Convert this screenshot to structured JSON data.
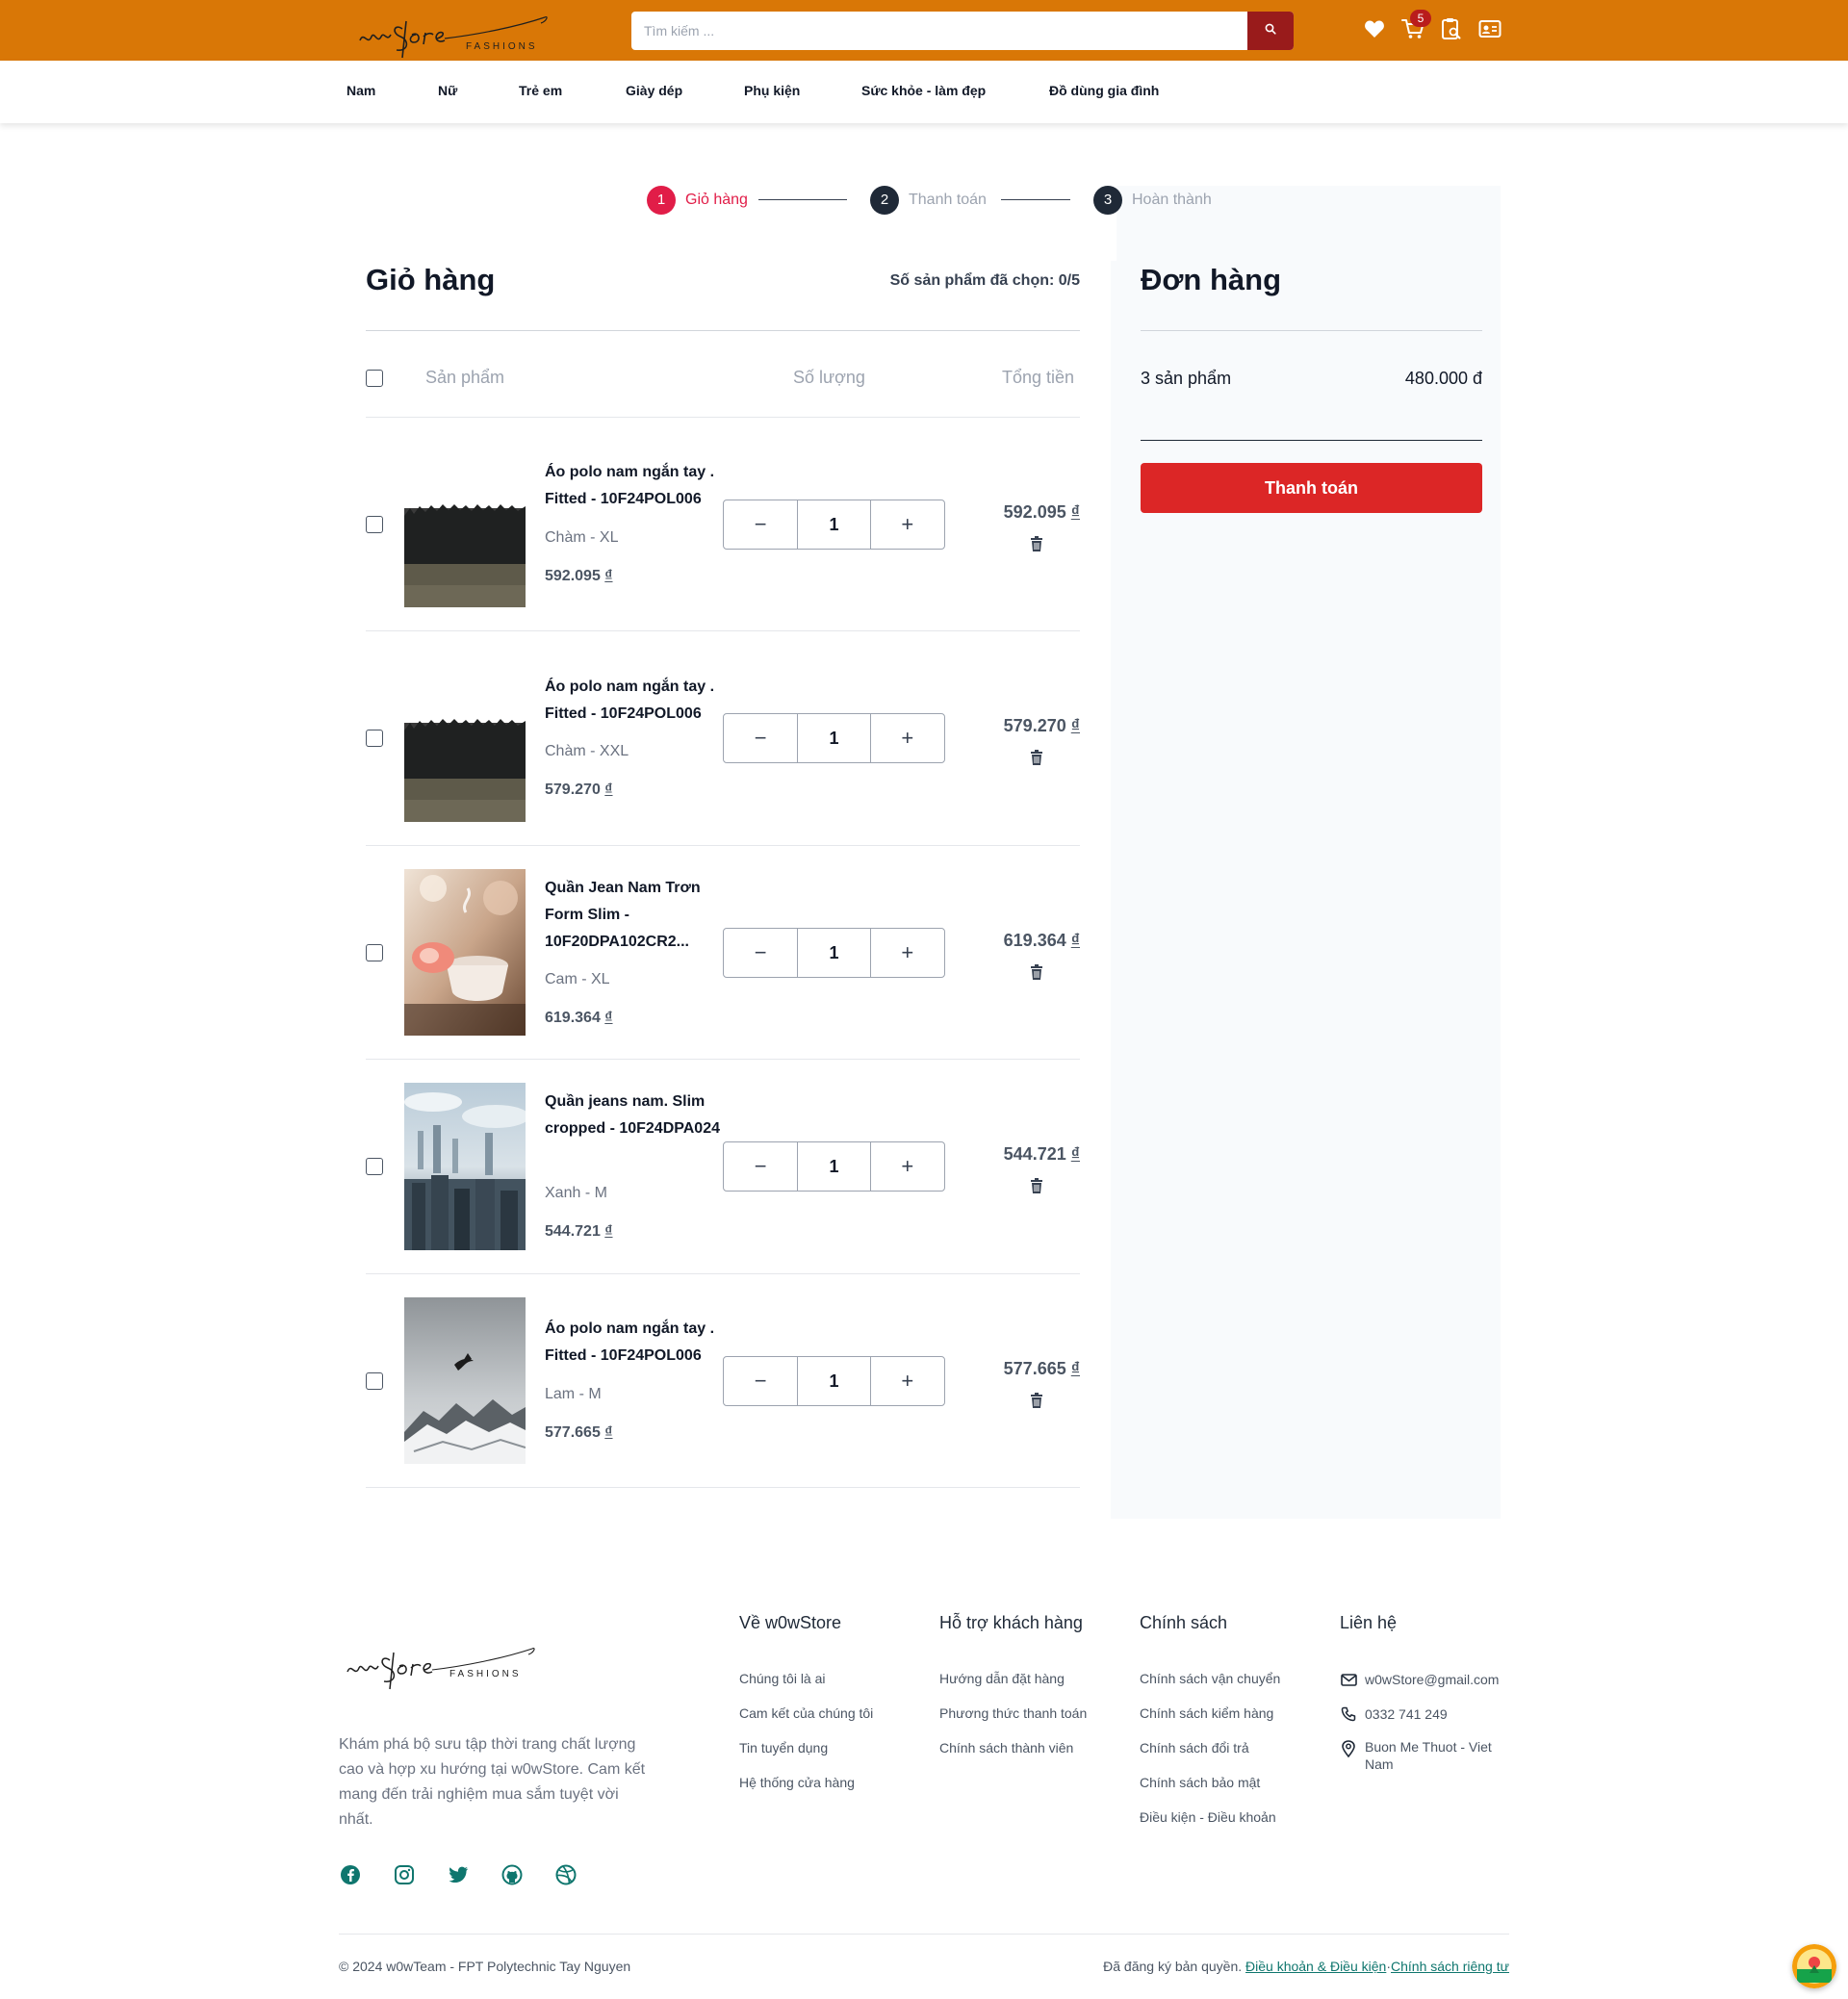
{
  "header": {
    "logo_text": "w0wStore",
    "logo_subtext": "FASHIONS",
    "search_placeholder": "Tìm kiếm ...",
    "cart_badge": "5",
    "brand_color": "#d97706"
  },
  "nav": {
    "items": [
      "Nam",
      "Nữ",
      "Trẻ em",
      "Giày dép",
      "Phụ kiện",
      "Sức khỏe - làm đẹp",
      "Đồ dùng gia đình"
    ]
  },
  "stepper": {
    "steps": [
      {
        "number": "1",
        "label": "Giỏ hàng",
        "active": true
      },
      {
        "number": "2",
        "label": "Thanh toán",
        "active": false
      },
      {
        "number": "3",
        "label": "Hoàn thành",
        "active": false
      }
    ],
    "active_color": "#e11d48"
  },
  "cart": {
    "title": "Giỏ hàng",
    "selected_count": "Số sản phẩm đã chọn: 0/5",
    "headers": {
      "product": "Sản phẩm",
      "quantity": "Số lượng",
      "total": "Tổng tiền"
    },
    "currency": "₫",
    "items": [
      {
        "name": "Áo polo nam ngắn tay . Fitted - 10F24POL006",
        "variant": "Chàm - XL",
        "price": "592.095",
        "qty": "1",
        "total": "592.095",
        "image": "forest"
      },
      {
        "name": "Áo polo nam ngắn tay . Fitted - 10F24POL006",
        "variant": "Chàm - XXL",
        "price": "579.270",
        "qty": "1",
        "total": "579.270",
        "image": "forest"
      },
      {
        "name": "Quần Jean Nam Trơn Form Slim - 10F20DPA102CR2...",
        "variant": "Cam - XL",
        "price": "619.364",
        "qty": "1",
        "total": "619.364",
        "image": "tea-cup"
      },
      {
        "name": "Quần jeans nam. Slim cropped - 10F24DPA024",
        "variant": "Xanh - M",
        "price": "544.721",
        "qty": "1",
        "total": "544.721",
        "image": "city-skyline"
      },
      {
        "name": "Áo polo nam ngắn tay . Fitted - 10F24POL006",
        "variant": "Lam - M",
        "price": "577.665",
        "qty": "1",
        "total": "577.665",
        "image": "mountain-bird"
      }
    ]
  },
  "order": {
    "title": "Đơn hàng",
    "count_label": "3 sản phẩm",
    "sum": "480.000 đ",
    "checkout_label": "Thanh toán"
  },
  "footer": {
    "description": "Khám phá bộ sưu tập thời trang chất lượng cao và hợp xu hướng tại w0wStore. Cam kết mang đến trải nghiệm mua sắm tuyệt vời nhất.",
    "social": [
      "facebook-icon",
      "instagram-icon",
      "twitter-icon",
      "github-icon",
      "dribbble-icon"
    ],
    "columns": [
      {
        "title": "Về w0wStore",
        "links": [
          "Chúng tôi là ai",
          "Cam kết của chúng tôi",
          "Tin tuyển dụng",
          "Hệ thống cửa hàng"
        ]
      },
      {
        "title": "Hỗ trợ khách hàng",
        "links": [
          "Hướng dẫn đặt hàng",
          "Phương thức thanh toán",
          "Chính sách thành viên"
        ]
      },
      {
        "title": "Chính sách",
        "links": [
          "Chính sách vận chuyển",
          "Chính sách kiểm hàng",
          "Chính sách đổi trả",
          "Chính sách bảo mật",
          "Điều kiện - Điều khoản"
        ]
      }
    ],
    "contact": {
      "title": "Liên hệ",
      "email": "w0wStore@gmail.com",
      "phone": "0332 741 249",
      "address": "Buon Me Thuot - Viet Nam"
    },
    "copyright": "© 2024 w0wTeam - FPT Polytechnic Tay Nguyen",
    "rights": "Đã đăng ký bản quyền.",
    "terms_link": "Điều khoản & Điều kiện",
    "separator": "·",
    "privacy_link": "Chính sách riêng tư"
  }
}
